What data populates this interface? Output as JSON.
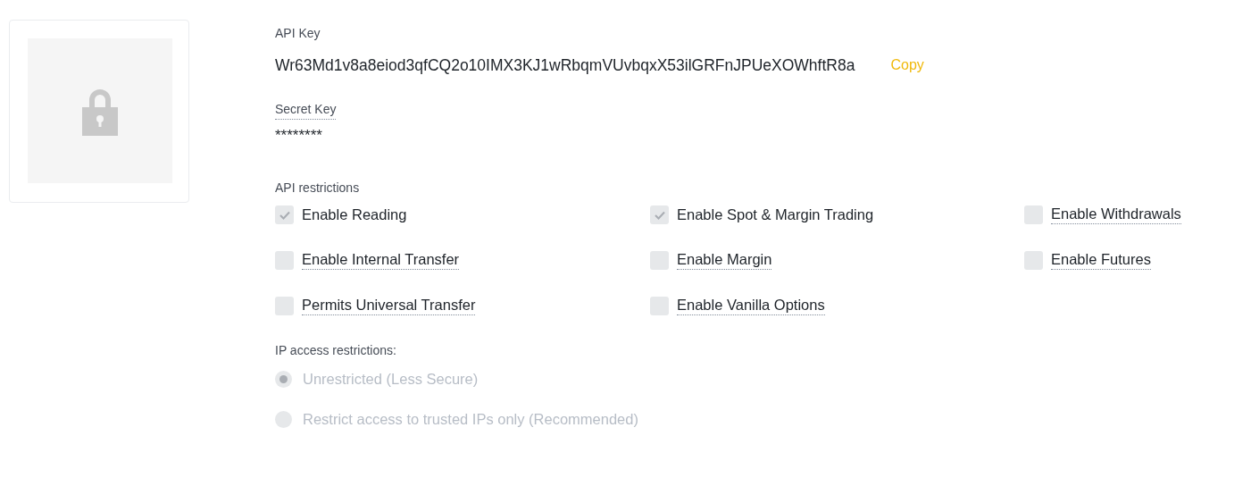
{
  "api_key": {
    "label": "API Key",
    "value": "Wr63Md1v8a8eiod3qfCQ2o10IMX3KJ1wRbqmVUvbqxX53ilGRFnJPUeXOWhftR8a",
    "copy_label": "Copy"
  },
  "secret_key": {
    "label": "Secret Key",
    "value": "********"
  },
  "api_restrictions": {
    "label": "API restrictions",
    "options": [
      {
        "label": "Enable Reading",
        "checked": true,
        "has_tooltip": false
      },
      {
        "label": "Enable Spot & Margin Trading",
        "checked": true,
        "has_tooltip": false
      },
      {
        "label": "Enable Withdrawals",
        "checked": false,
        "has_tooltip": true
      },
      {
        "label": "Enable Internal Transfer",
        "checked": false,
        "has_tooltip": true
      },
      {
        "label": "Enable Margin",
        "checked": false,
        "has_tooltip": true
      },
      {
        "label": "Enable Futures",
        "checked": false,
        "has_tooltip": true
      },
      {
        "label": "Permits Universal Transfer",
        "checked": false,
        "has_tooltip": true
      },
      {
        "label": "Enable Vanilla Options",
        "checked": false,
        "has_tooltip": true
      }
    ]
  },
  "ip_restrictions": {
    "label": "IP access restrictions:",
    "disabled": true,
    "options": [
      {
        "label": "Unrestricted (Less Secure)",
        "selected": true
      },
      {
        "label": "Restrict access to trusted IPs only (Recommended)",
        "selected": false
      }
    ]
  }
}
